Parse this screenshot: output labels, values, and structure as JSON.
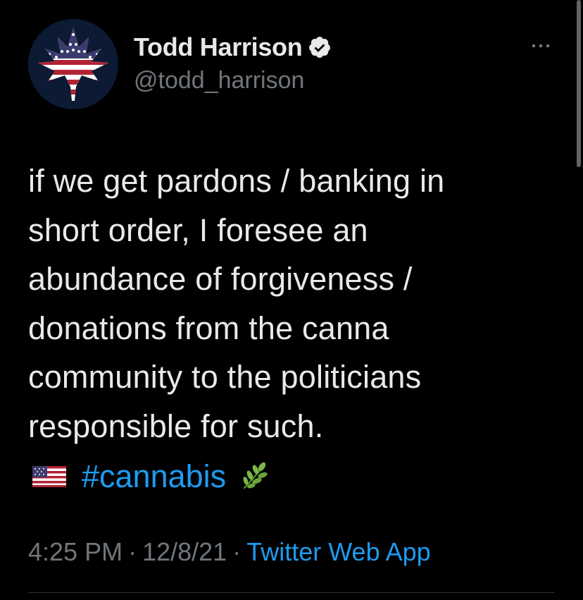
{
  "author": {
    "display_name": "Todd Harrison",
    "handle": "@todd_harrison",
    "avatar_icon": "american-flag-cannabis-leaf-icon",
    "verified_icon": "verified-badge-icon"
  },
  "menu": {
    "icon": "more-options-icon"
  },
  "tweet": {
    "lines": [
      "if we get pardons / banking in",
      "short order, I foresee an",
      "abundance of forgiveness /",
      "donations from the canna",
      "community to the politicians",
      "responsible for such."
    ],
    "hashtag": "#cannabis",
    "flag_icon": "us-flag-icon",
    "leaf_icon": "herb-leaf-icon"
  },
  "meta": {
    "time": "4:25 PM",
    "date": "12/8/21",
    "separator": "·",
    "source": "Twitter Web App"
  },
  "colors": {
    "background": "#000000",
    "text": "#e7e9ea",
    "secondary": "#71767b",
    "link": "#1d9bf0"
  }
}
